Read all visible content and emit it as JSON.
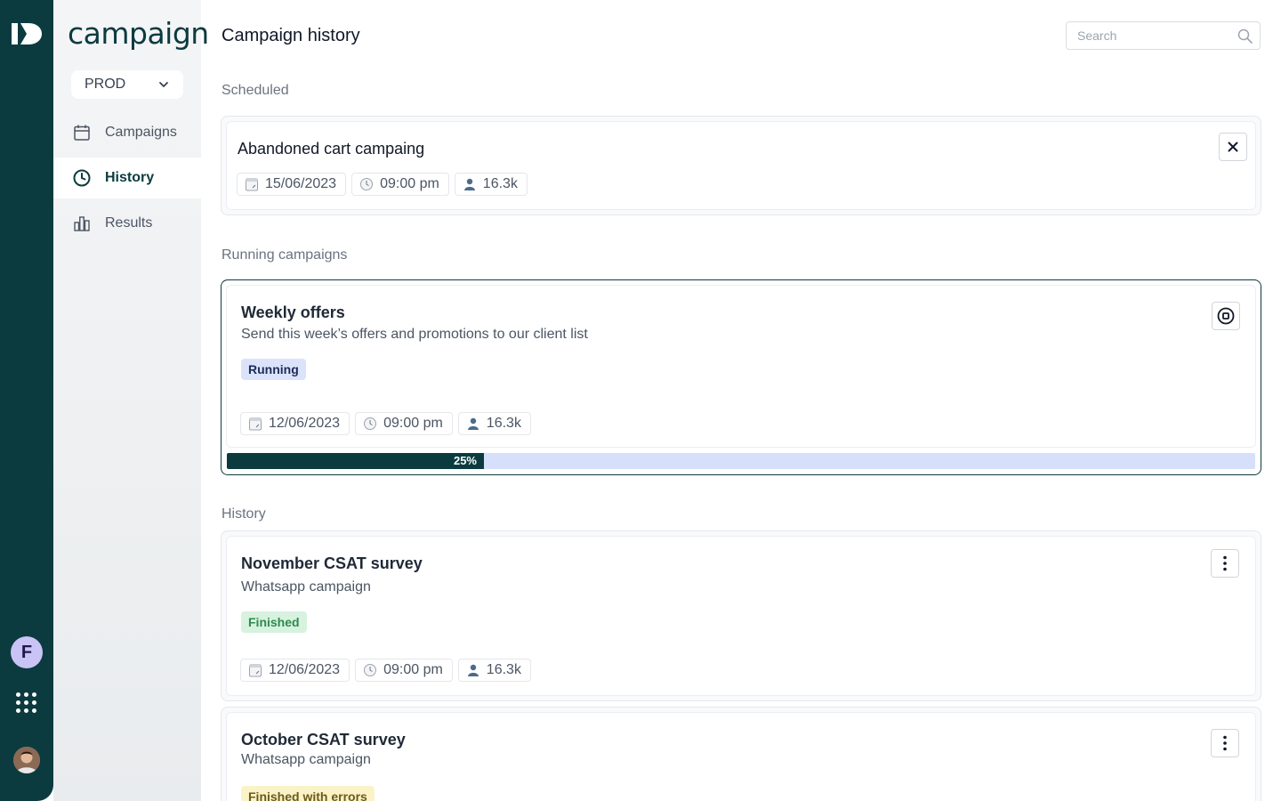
{
  "app": {
    "brand": "campaign",
    "environment": "PROD",
    "user_initial": "F"
  },
  "nav": {
    "items": [
      {
        "label": "Campaigns",
        "icon": "calendar-icon"
      },
      {
        "label": "History",
        "icon": "clock-icon",
        "active": true
      },
      {
        "label": "Results",
        "icon": "bar-chart-icon"
      }
    ]
  },
  "header": {
    "title": "Campaign history",
    "search_placeholder": "Search"
  },
  "sections": {
    "scheduled": "Scheduled",
    "running": "Running campaigns",
    "history": "History"
  },
  "scheduled_campaign": {
    "title": "Abandoned cart campaing",
    "date": "15/06/2023",
    "time": "09:00 pm",
    "audience": "16.3k"
  },
  "running_campaign": {
    "title": "Weekly offers",
    "description": "Send this week’s offers and promotions to our client list",
    "status": "Running",
    "date": "12/06/2023",
    "time": "09:00 pm",
    "audience": "16.3k",
    "progress_label": "25%",
    "progress_value": 0.25
  },
  "history_campaigns": [
    {
      "title": "November CSAT survey",
      "channel": "Whatsapp campaign",
      "status": "Finished",
      "date": "12/06/2023",
      "time": "09:00 pm",
      "audience": "16.3k"
    },
    {
      "title": "October CSAT survey",
      "channel": "Whatsapp campaign",
      "status": "Finished with errors"
    }
  ],
  "colors": {
    "primary": "#0b3b3f",
    "progress_track": "#d6e0fb",
    "finished": "#2f8a4e",
    "running_badge": "#dbe3fb",
    "errors_badge": "#fbf3c8"
  }
}
